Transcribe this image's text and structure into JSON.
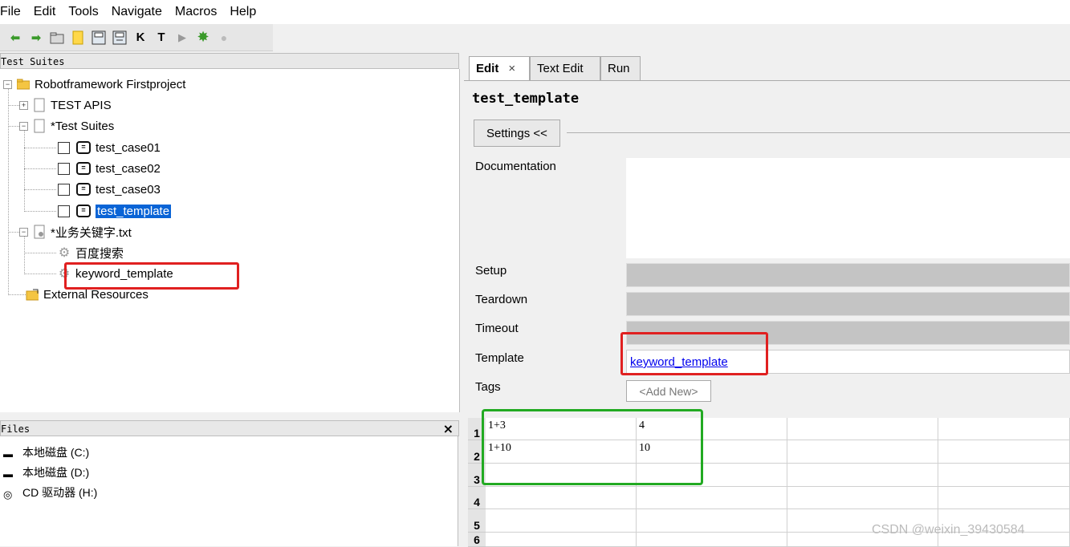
{
  "menu": [
    "File",
    "Edit",
    "Tools",
    "Navigate",
    "Macros",
    "Help"
  ],
  "toolbar": {
    "k_label": "K",
    "t_label": "T"
  },
  "left": {
    "suites_title": "Test Suites",
    "files_title": "Files",
    "files_close": "×",
    "tree": {
      "project": "Robotframework Firstproject",
      "test_apis": "TEST APIS",
      "test_suites": "*Test Suites",
      "cases": [
        "test_case01",
        "test_case02",
        "test_case03",
        "test_template"
      ],
      "keywords_file": "*业务关键字.txt",
      "keywords": [
        "百度搜索",
        "keyword_template"
      ],
      "external": "External Resources"
    },
    "files": [
      "本地磁盘 (C:)",
      "本地磁盘 (D:)",
      "CD 驱动器 (H:)"
    ]
  },
  "tabs": {
    "edit": "Edit",
    "edit_close": "×",
    "text_edit": "Text Edit",
    "run": "Run"
  },
  "editor": {
    "name": "test_template",
    "settings_button": "Settings <<",
    "labels": {
      "documentation": "Documentation",
      "setup": "Setup",
      "teardown": "Teardown",
      "timeout": "Timeout",
      "template": "Template",
      "tags": "Tags"
    },
    "template_value": "keyword_template",
    "tags_placeholder": "<Add New>"
  },
  "grid": {
    "row_numbers": [
      "1",
      "2",
      "3",
      "4",
      "5",
      "6"
    ],
    "rows": [
      [
        "1+3",
        "4"
      ],
      [
        "1+10",
        "10"
      ]
    ]
  },
  "watermark": "CSDN @weixin_39430584",
  "colors": {
    "selection": "#0a64d6",
    "highlight_red": "#e02020",
    "highlight_green": "#22aa22"
  }
}
